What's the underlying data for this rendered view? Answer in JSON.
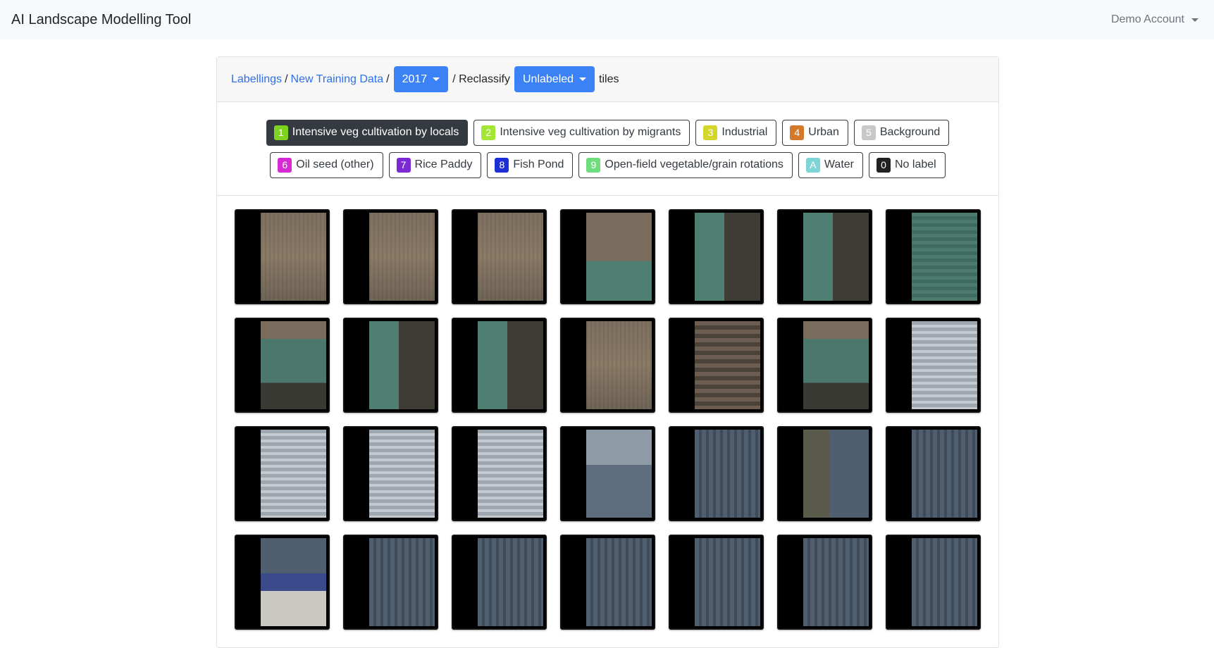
{
  "app": {
    "title": "AI Landscape Modelling Tool",
    "account": "Demo Account"
  },
  "breadcrumb": {
    "labellings": "Labellings",
    "sep1": "/",
    "training": "New Training Data",
    "sep2": "/",
    "year": "2017",
    "sep3": "/ Reclassify",
    "filter": "Unlabeled",
    "suffix": "tiles"
  },
  "labels": [
    {
      "key": "1",
      "name": "Intensive veg cultivation by locals",
      "color": "#7ed321",
      "active": true
    },
    {
      "key": "2",
      "name": "Intensive veg cultivation by migrants",
      "color": "#a3e635",
      "active": false
    },
    {
      "key": "3",
      "name": "Industrial",
      "color": "#d4d62a",
      "active": false
    },
    {
      "key": "4",
      "name": "Urban",
      "color": "#d4782a",
      "active": false
    },
    {
      "key": "5",
      "name": "Background",
      "color": "#c8c8c8",
      "active": false
    },
    {
      "key": "6",
      "name": "Oil seed (other)",
      "color": "#d62ad4",
      "active": false
    },
    {
      "key": "7",
      "name": "Rice Paddy",
      "color": "#7b2ad4",
      "active": false
    },
    {
      "key": "8",
      "name": "Fish Pond",
      "color": "#1f2fd6",
      "active": false
    },
    {
      "key": "9",
      "name": "Open-field vegetable/grain rotations",
      "color": "#6fdc7e",
      "active": false
    },
    {
      "key": "A",
      "name": "Water",
      "color": "#7fd4d6",
      "active": false
    },
    {
      "key": "0",
      "name": "No label",
      "color": "#222222",
      "active": false
    }
  ],
  "tiles": [
    "brown",
    "brown",
    "brown",
    "brownGreen",
    "greenDark",
    "greenDark",
    "green",
    "greenStripe",
    "greenDark",
    "greenDark",
    "brown",
    "brownDark",
    "greenStripe",
    "greyStripe",
    "greyStripe",
    "greyStripe",
    "greyStripe",
    "greyBlue",
    "blueGrey",
    "mixed",
    "blueGrey",
    "building",
    "blueGrey",
    "blueGrey",
    "blueGrey",
    "blueGrey",
    "blueGrey",
    "blueGrey"
  ]
}
